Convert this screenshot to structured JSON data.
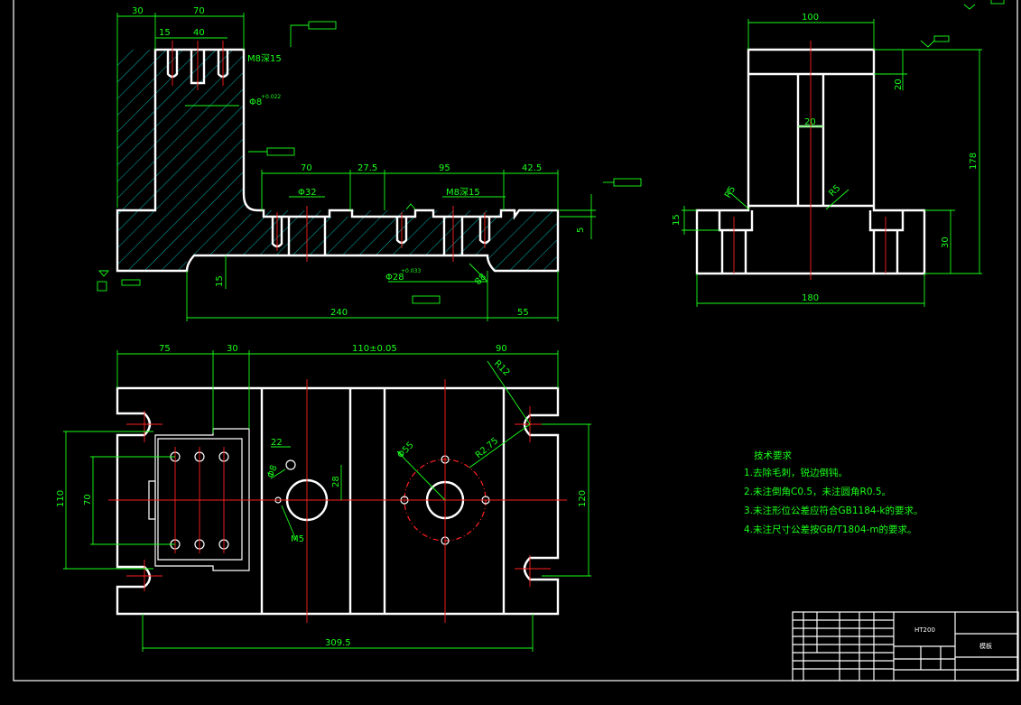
{
  "colors": {
    "background": "#000000",
    "outline": "#ffffff",
    "dimension": "#19ff19",
    "centerline": "#ff2020",
    "hatch": "#00e5e5"
  },
  "front_view": {
    "dims": {
      "d30": "30",
      "d70_top": "70",
      "d15_a": "15",
      "d40": "40",
      "m8_top": "M8深15",
      "dia8": "Φ8",
      "dia8_tol": "+0.022",
      "d70": "70",
      "d27_5": "27.5",
      "d95": "95",
      "d42_5": "42.5",
      "dia32": "Φ32",
      "m8_mid": "M8深15",
      "d5": "5",
      "d15_b": "15",
      "dia28": "Φ28",
      "dia28_tol": "+0.033",
      "d240": "240",
      "d55": "55",
      "d88": "88"
    }
  },
  "side_view": {
    "dims": {
      "d100": "100",
      "d20_a": "20",
      "d20_b": "20",
      "d178": "178",
      "r15_a": "R5",
      "r15_b": "R5",
      "d15": "15",
      "d30": "30",
      "d180": "180"
    }
  },
  "top_view": {
    "dims": {
      "d75": "75",
      "d30": "30",
      "d110": "110±0.05",
      "d90": "90",
      "r12": "R12",
      "r2_75": "R2.75",
      "dia55": "Φ55",
      "d22": "22",
      "dia8": "Φ8",
      "d28": "28",
      "m5": "M5",
      "d70": "70",
      "d110_v": "110",
      "d120": "120",
      "d309_5": "309.5"
    }
  },
  "notes": {
    "title": "技术要求",
    "items": [
      "1.去除毛刺，锐边倒钝。",
      "2.未注倒角C0.5，未注圆角R0.5。",
      "3.未注形位公差应符合GB1184-k的要求。",
      "4.未注尺寸公差按GB/T1804-m的要求。"
    ]
  },
  "title_block": {
    "material": "HT200",
    "drawing_name": "模板"
  }
}
